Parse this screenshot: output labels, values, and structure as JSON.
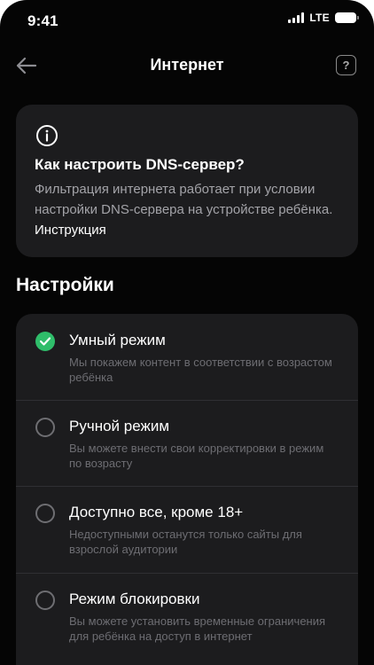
{
  "status_bar": {
    "time": "9:41",
    "network": "LTE"
  },
  "header": {
    "title": "Интернет",
    "help_label": "?"
  },
  "info_card": {
    "title": "Как настроить DNS-сервер?",
    "text": "Фильтрация интернета работает при условии настройки DNS-сервера на устройстве ребёнка.",
    "link": "Инструкция"
  },
  "settings": {
    "title": "Настройки",
    "options": [
      {
        "label": "Умный режим",
        "description": "Мы покажем контент в соответствии с возрастом ребёнка",
        "selected": true
      },
      {
        "label": "Ручной режим",
        "description": "Вы можете внести свои корректировки в режим по возрасту",
        "selected": false
      },
      {
        "label": "Доступно все, кроме 18+",
        "description": "Недоступными останутся только сайты для взрослой аудитории",
        "selected": false
      },
      {
        "label": "Режим блокировки",
        "description": "Вы можете установить временные ограничения для ребёнка на доступ в интернет",
        "selected": false
      }
    ]
  },
  "colors": {
    "background": "#050505",
    "card": "#1c1c1e",
    "accent_green": "#2fbd6a",
    "muted_text": "#6d6d72"
  },
  "icons": {
    "back": "arrow-left-icon",
    "help": "question-square-icon",
    "info": "info-circle-icon",
    "check": "check-icon"
  }
}
